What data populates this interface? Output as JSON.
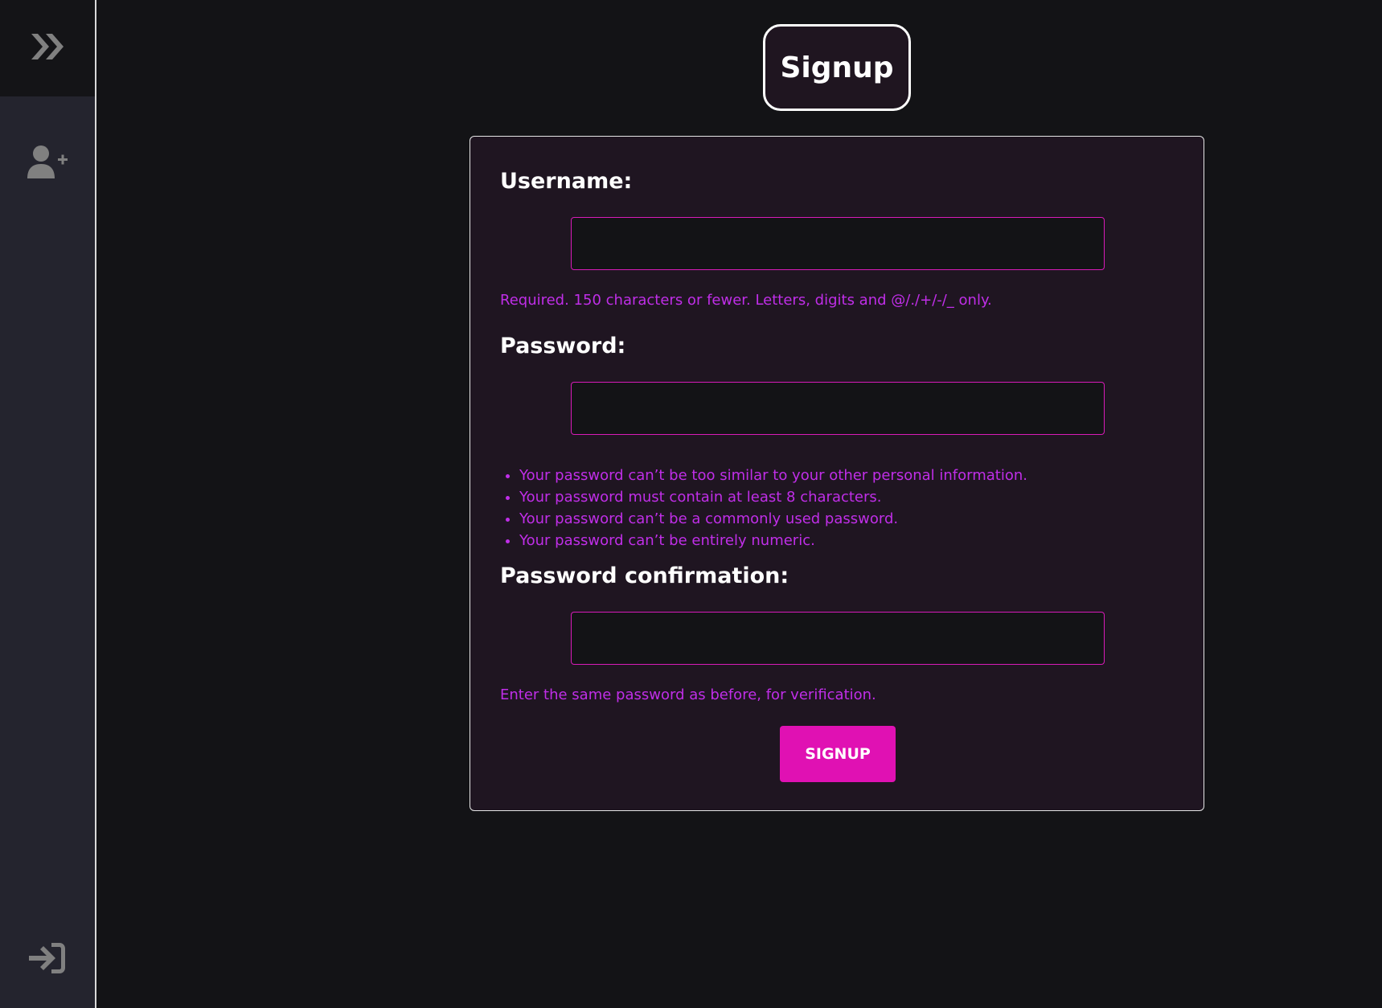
{
  "sidebar": {
    "toggle_icon": "double-chevron-right-icon",
    "signup_icon": "user-plus-icon",
    "login_icon": "sign-in-icon",
    "icon_color": "#808080"
  },
  "page": {
    "title": "Signup"
  },
  "form": {
    "username_label": "Username:",
    "username_value": "",
    "username_help": "Required. 150 characters or fewer. Letters, digits and @/./+/-/_ only.",
    "password_label": "Password:",
    "password_value": "",
    "password_rules": [
      "Your password can’t be too similar to your other personal information.",
      "Your password must contain at least 8 characters.",
      "Your password can’t be a commonly used password.",
      "Your password can’t be entirely numeric."
    ],
    "confirm_label": "Password confirmation:",
    "confirm_value": "",
    "confirm_help": "Enter the same password as before, for verification.",
    "submit_label": "SIGNUP"
  },
  "colors": {
    "accent": "#e011b3",
    "help_text": "#c02ee8",
    "background": "#131316",
    "card": "#1f1521"
  }
}
